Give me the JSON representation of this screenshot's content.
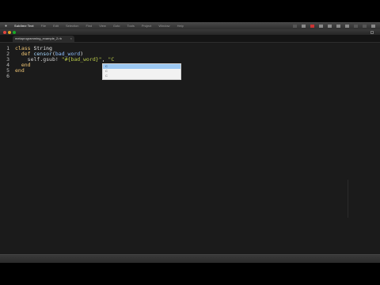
{
  "menubar": {
    "app_name": "Sublime Text",
    "items": [
      "File",
      "Edit",
      "Selection",
      "Find",
      "View",
      "Goto",
      "Tools",
      "Project",
      "Window",
      "Help"
    ]
  },
  "window": {
    "tab_label": "metaprogramming_example_2.rb",
    "tab_close": "×"
  },
  "editor": {
    "line_numbers": [
      "1",
      "2",
      "3",
      "4",
      "5",
      "6"
    ],
    "lines": [
      [
        {
          "t": "class ",
          "c": "kw"
        },
        {
          "t": "String",
          "c": "cls"
        }
      ],
      [
        {
          "t": "  def ",
          "c": "kw"
        },
        {
          "t": "censor",
          "c": "fn"
        },
        {
          "t": "(",
          "c": "cls"
        },
        {
          "t": "bad_word",
          "c": "var"
        },
        {
          "t": ")",
          "c": "cls"
        }
      ],
      [
        {
          "t": "    self",
          "c": "meth"
        },
        {
          "t": ".",
          "c": "cls"
        },
        {
          "t": "gsub! ",
          "c": "meth"
        },
        {
          "t": "\"#{bad_word}\"",
          "c": "str"
        },
        {
          "t": ", ",
          "c": "cls"
        },
        {
          "t": "\"C",
          "c": "str"
        }
      ],
      [
        {
          "t": "  end",
          "c": "kw"
        }
      ],
      [
        {
          "t": "end",
          "c": "kw"
        }
      ],
      [
        {
          "t": "",
          "c": "cls"
        }
      ]
    ]
  },
  "autocomplete": {
    "items": [
      "C",
      "C",
      "C"
    ],
    "selected_index": 0
  }
}
